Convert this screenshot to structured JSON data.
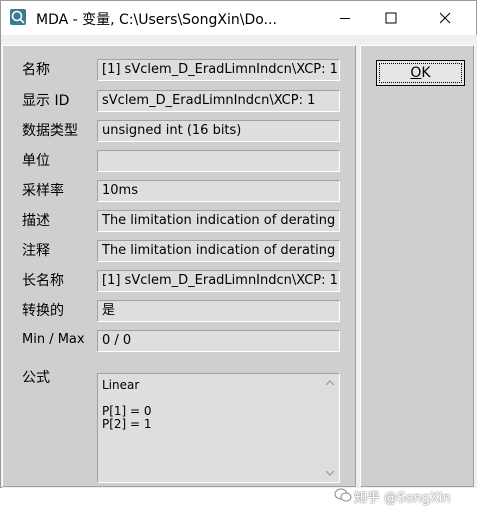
{
  "window": {
    "title": "MDA - 变量, C:\\Users\\SongXin\\Do...",
    "minimize_icon": "minimize-icon",
    "maximize_icon": "maximize-icon",
    "close_icon": "close-icon"
  },
  "fields": [
    {
      "label": "名称",
      "value": "[1]  sVclem_D_EradLimnIndcn\\XCP: 1"
    },
    {
      "label": "显示 ID",
      "value": "sVclem_D_EradLimnIndcn\\XCP: 1"
    },
    {
      "label": "数据类型",
      "value": "unsigned int    (16 bits)"
    },
    {
      "label": "单位",
      "value": ""
    },
    {
      "label": "采样率",
      "value": "10ms"
    },
    {
      "label": "描述",
      "value": "The limitation indication of derating conditions"
    },
    {
      "label": "注释",
      "value": "The limitation indication of derating conditions"
    },
    {
      "label": "长名称",
      "value": "[1]  sVclem_D_EradLimnIndcn\\XCP: 1"
    },
    {
      "label": "转换的",
      "value": "是"
    },
    {
      "label": "Min / Max",
      "value": "0 / 0"
    }
  ],
  "formula": {
    "label": "公式",
    "text": "Linear\n\nP[1] = 0\nP[2] = 1"
  },
  "ok_button": {
    "label": "OK",
    "underlined_char": "O",
    "rest": "K"
  },
  "watermark": {
    "text": "知乎 @SongXin"
  }
}
